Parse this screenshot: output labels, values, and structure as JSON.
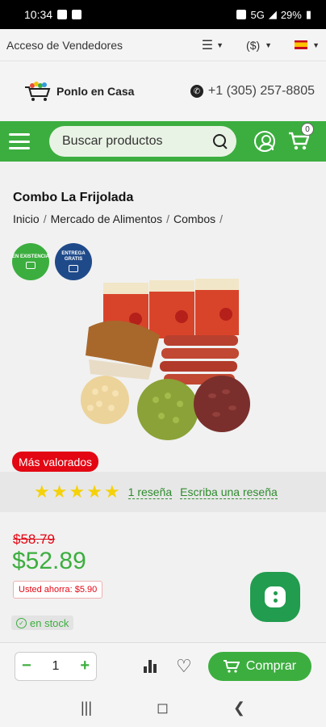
{
  "status_bar": {
    "time": "10:34",
    "network": "5G",
    "battery": "29%"
  },
  "top_bar": {
    "vendors_label": "Acceso de Vendedores",
    "currency": "($)",
    "language_flag": "es"
  },
  "brand": {
    "name": "Ponlo en Casa",
    "phone": "+1 (305) 257-8805"
  },
  "nav": {
    "search_placeholder": "Buscar productos",
    "cart_count": "0"
  },
  "product": {
    "title": "Combo La Frijolada",
    "breadcrumbs": [
      "Inicio",
      "Mercado de Alimentos",
      "Combos"
    ],
    "badge_stock": "EN EXISTENCIA",
    "badge_shipping": "ENTREGA GRATIS",
    "top_rated_label": "Más valorados",
    "rating_stars": 5,
    "reviews_link": "1 reseña",
    "write_review_link": "Escriba una reseña",
    "price_old": "$58.79",
    "price_new": "$52.89",
    "savings": "Usted ahorra: $5.90",
    "stock_label": "en stock"
  },
  "buy_bar": {
    "quantity": "1",
    "minus": "−",
    "plus": "+",
    "buy_label": "Comprar"
  },
  "colors": {
    "primary_green": "#3cae3f",
    "sale_red": "#e30613",
    "star_yellow": "#f5d10a",
    "navy": "#1f4a8a"
  }
}
